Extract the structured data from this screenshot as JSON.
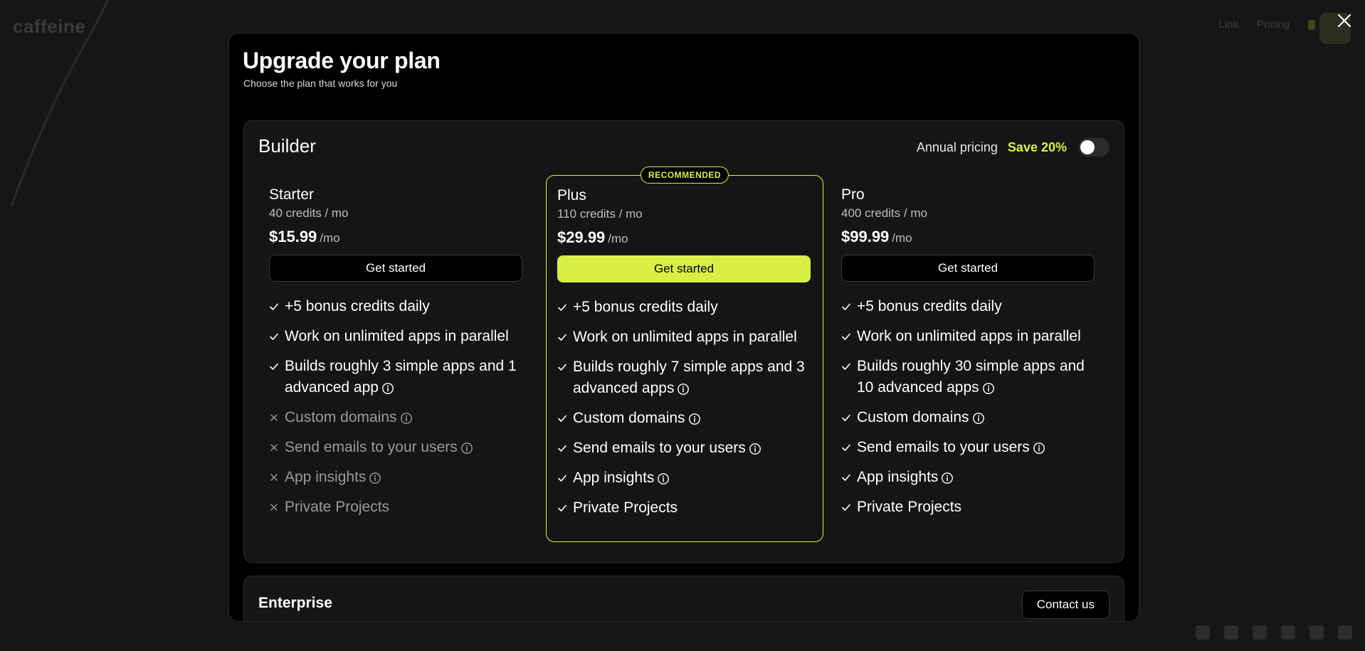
{
  "background": {
    "logo": "caffeine",
    "nav_links": [
      "Link",
      "Pricing"
    ]
  },
  "modal": {
    "title": "Upgrade your plan",
    "subtitle": "Choose the plan that works for you"
  },
  "builder": {
    "title": "Builder",
    "annual_label": "Annual pricing",
    "save_label": "Save 20%",
    "annual_toggle_on": false,
    "plans": [
      {
        "name": "Starter",
        "credits": "40 credits / mo",
        "price": "$15.99",
        "per": "/mo",
        "cta": "Get started",
        "recommended": false,
        "features": [
          {
            "text": "+5 bonus credits daily",
            "included": true,
            "info": false
          },
          {
            "text": "Work on unlimited apps in parallel",
            "included": true,
            "info": false
          },
          {
            "text": "Builds roughly 3 simple apps and 1 advanced app",
            "included": true,
            "info": true
          },
          {
            "text": "Custom domains",
            "included": false,
            "info": true
          },
          {
            "text": "Send emails to your users",
            "included": false,
            "info": true
          },
          {
            "text": "App insights",
            "included": false,
            "info": true
          },
          {
            "text": "Private Projects",
            "included": false,
            "info": false
          }
        ]
      },
      {
        "name": "Plus",
        "credits": "110 credits / mo",
        "price": "$29.99",
        "per": "/mo",
        "cta": "Get started",
        "recommended": true,
        "badge": "RECOMMENDED",
        "features": [
          {
            "text": "+5 bonus credits daily",
            "included": true,
            "info": false
          },
          {
            "text": "Work on unlimited apps in parallel",
            "included": true,
            "info": false
          },
          {
            "text": "Builds roughly 7 simple apps and 3 advanced apps",
            "included": true,
            "info": true
          },
          {
            "text": "Custom domains",
            "included": true,
            "info": true
          },
          {
            "text": "Send emails to your users",
            "included": true,
            "info": true
          },
          {
            "text": "App insights",
            "included": true,
            "info": true
          },
          {
            "text": "Private Projects",
            "included": true,
            "info": false
          }
        ]
      },
      {
        "name": "Pro",
        "credits": "400 credits / mo",
        "price": "$99.99",
        "per": "/mo",
        "cta": "Get started",
        "recommended": false,
        "features": [
          {
            "text": "+5 bonus credits daily",
            "included": true,
            "info": false
          },
          {
            "text": "Work on unlimited apps in parallel",
            "included": true,
            "info": false
          },
          {
            "text": "Builds roughly 30 simple apps and 10 advanced apps",
            "included": true,
            "info": true
          },
          {
            "text": "Custom domains",
            "included": true,
            "info": true
          },
          {
            "text": "Send emails to your users",
            "included": true,
            "info": true
          },
          {
            "text": "App insights",
            "included": true,
            "info": true
          },
          {
            "text": "Private Projects",
            "included": true,
            "info": false
          }
        ]
      }
    ]
  },
  "enterprise": {
    "title": "Enterprise",
    "cta": "Contact us"
  },
  "colors": {
    "accent": "#d8f046",
    "modal_bg": "#000000",
    "card_bg": "#151515"
  }
}
